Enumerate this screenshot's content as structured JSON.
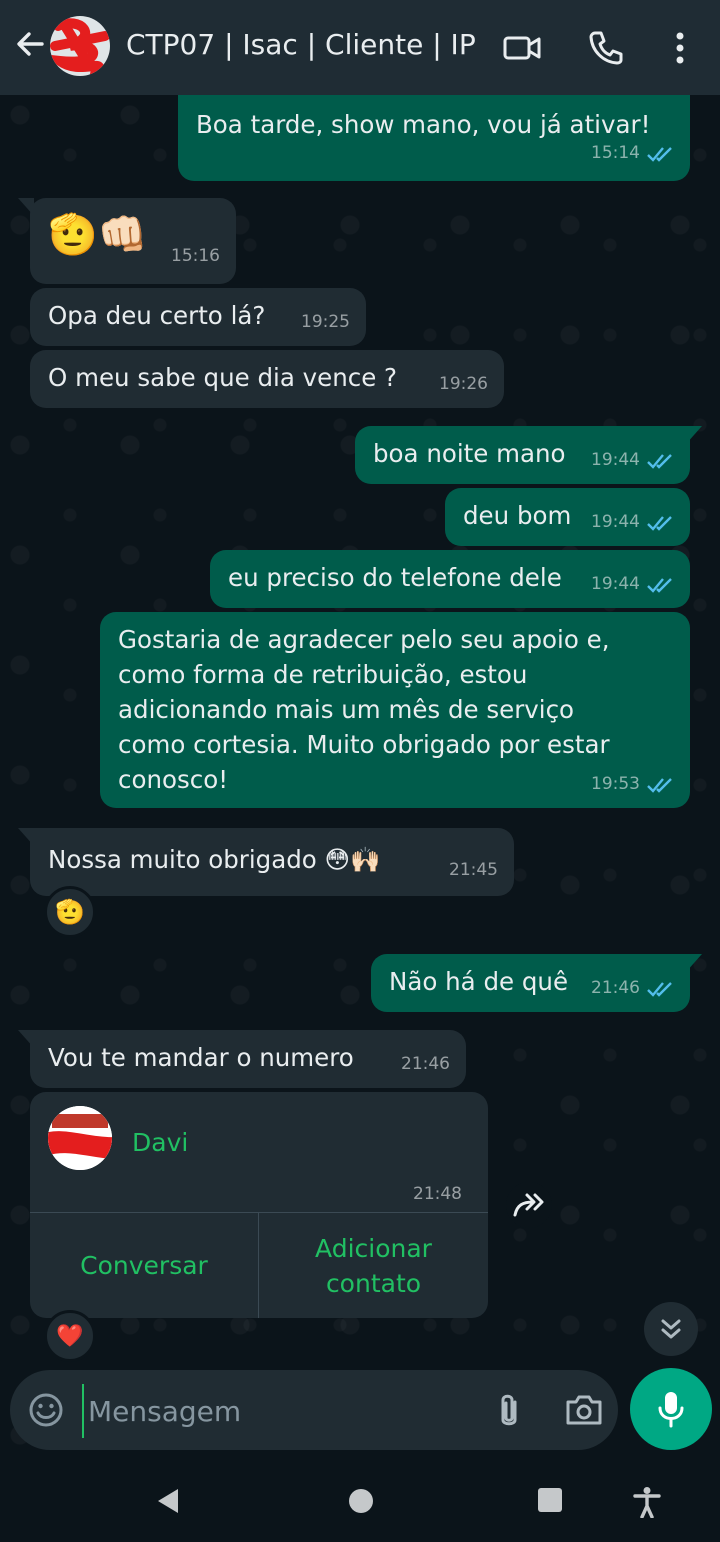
{
  "header": {
    "title": "CTP07 | Isac | Cliente | IP",
    "icons": [
      "back-arrow-icon",
      "video-call-icon",
      "phone-icon",
      "more-vert-icon"
    ]
  },
  "messages": [
    {
      "dir": "out",
      "text": "Boa tarde, show mano, vou já ativar!",
      "time": "15:14",
      "status": "read"
    },
    {
      "dir": "in",
      "text": "🫡👊🏻",
      "time": "15:16"
    },
    {
      "dir": "in",
      "text": "Opa deu certo lá?",
      "time": "19:25"
    },
    {
      "dir": "in",
      "text": "O meu sabe que dia vence ?",
      "time": "19:26"
    },
    {
      "dir": "out",
      "text": "boa noite mano",
      "time": "19:44",
      "status": "read"
    },
    {
      "dir": "out",
      "text": "deu bom",
      "time": "19:44",
      "status": "read"
    },
    {
      "dir": "out",
      "text": "eu preciso do telefone dele",
      "time": "19:44",
      "status": "read"
    },
    {
      "dir": "out",
      "text": "Gostaria de agradecer pelo seu apoio e, como forma de retribuição, estou adicionando mais um mês de serviço como cortesia. Muito obrigado por estar conosco!",
      "time": "19:53",
      "status": "read"
    },
    {
      "dir": "in",
      "text": "Nossa muito obrigado 😳🙌🏻",
      "time": "21:45",
      "reaction": "🫡"
    },
    {
      "dir": "out",
      "text": "Não há de quê",
      "time": "21:46",
      "status": "read"
    },
    {
      "dir": "in",
      "text": "Vou te mandar o numero",
      "time": "21:46"
    }
  ],
  "contact_card": {
    "name": "Davi",
    "time": "21:48",
    "actions": [
      "Conversar",
      "Adicionar contato"
    ],
    "reaction": "❤️"
  },
  "composer": {
    "placeholder": "Mensagem"
  },
  "colors": {
    "background": "#0b141a",
    "header": "#1f2c34",
    "incoming": "#202c33",
    "outgoing": "#005c4b",
    "accent": "#21c063",
    "mic": "#00a884",
    "read_ticks": "#53bdeb"
  }
}
